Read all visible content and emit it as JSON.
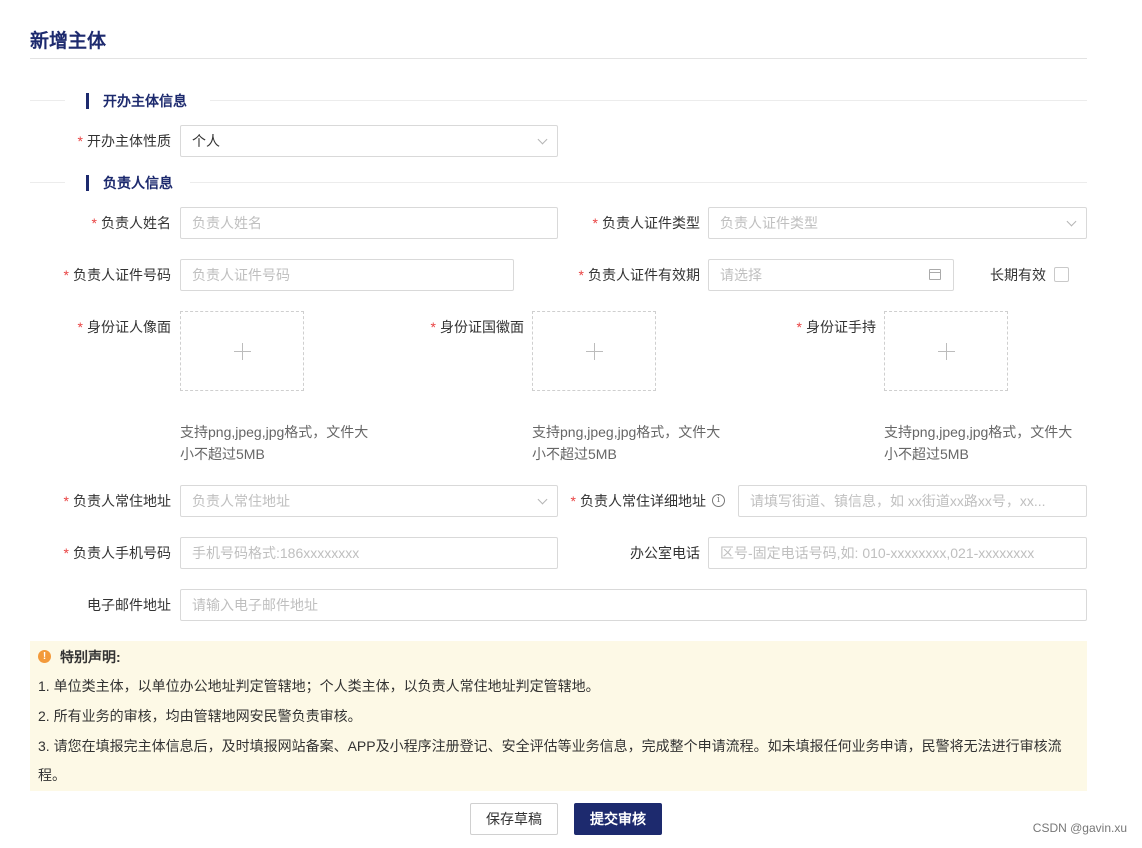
{
  "page": {
    "title": "新增主体"
  },
  "sections": {
    "entity": "开办主体信息",
    "person": "负责人信息"
  },
  "form": {
    "nature": {
      "label": "开办主体性质",
      "value": "个人"
    },
    "name": {
      "label": "负责人姓名",
      "placeholder": "负责人姓名"
    },
    "id_type": {
      "label": "负责人证件类型",
      "placeholder": "负责人证件类型"
    },
    "id_number": {
      "label": "负责人证件号码",
      "placeholder": "负责人证件号码"
    },
    "id_validity": {
      "label": "负责人证件有效期",
      "placeholder": "请选择"
    },
    "long_term": {
      "label": "长期有效",
      "checked": false
    },
    "uploads": [
      {
        "label": "身份证人像面",
        "hint": "支持png,jpeg,jpg格式，文件大小不超过5MB"
      },
      {
        "label": "身份证国徽面",
        "hint": "支持png,jpeg,jpg格式，文件大小不超过5MB"
      },
      {
        "label": "身份证手持",
        "hint": "支持png,jpeg,jpg格式，文件大小不超过5MB"
      }
    ],
    "address": {
      "label": "负责人常住地址",
      "placeholder": "负责人常住地址"
    },
    "detail_address": {
      "label": "负责人常住详细地址",
      "placeholder": "请填写街道、镇信息，如 xx街道xx路xx号，xx..."
    },
    "phone": {
      "label": "负责人手机号码",
      "placeholder": "手机号码格式:186xxxxxxxx"
    },
    "office_phone": {
      "label": "办公室电话",
      "placeholder": "区号-固定电话号码,如: 010-xxxxxxxx,021-xxxxxxxx"
    },
    "email": {
      "label": "电子邮件地址",
      "placeholder": "请输入电子邮件地址"
    }
  },
  "notice": {
    "title": "特别声明:",
    "lines": [
      "1. 单位类主体，以单位办公地址判定管辖地；个人类主体，以负责人常住地址判定管辖地。",
      "2. 所有业务的审核，均由管辖地网安民警负责审核。",
      "3. 请您在填报完主体信息后，及时填报网站备案、APP及小程序注册登记、安全评估等业务信息，完成整个申请流程。如未填报任何业务申请，民警将无法进行审核流程。"
    ]
  },
  "buttons": {
    "draft": "保存草稿",
    "submit": "提交审核"
  },
  "watermark": "CSDN @gavin.xu",
  "colors": {
    "primary": "#1d2a6e",
    "required": "#e94242",
    "notice_bg": "#fdf9e6",
    "warn": "#f39a3b"
  },
  "icons": [
    "chevron-down-icon",
    "calendar-icon",
    "plus-icon",
    "info-icon",
    "warning-icon"
  ]
}
